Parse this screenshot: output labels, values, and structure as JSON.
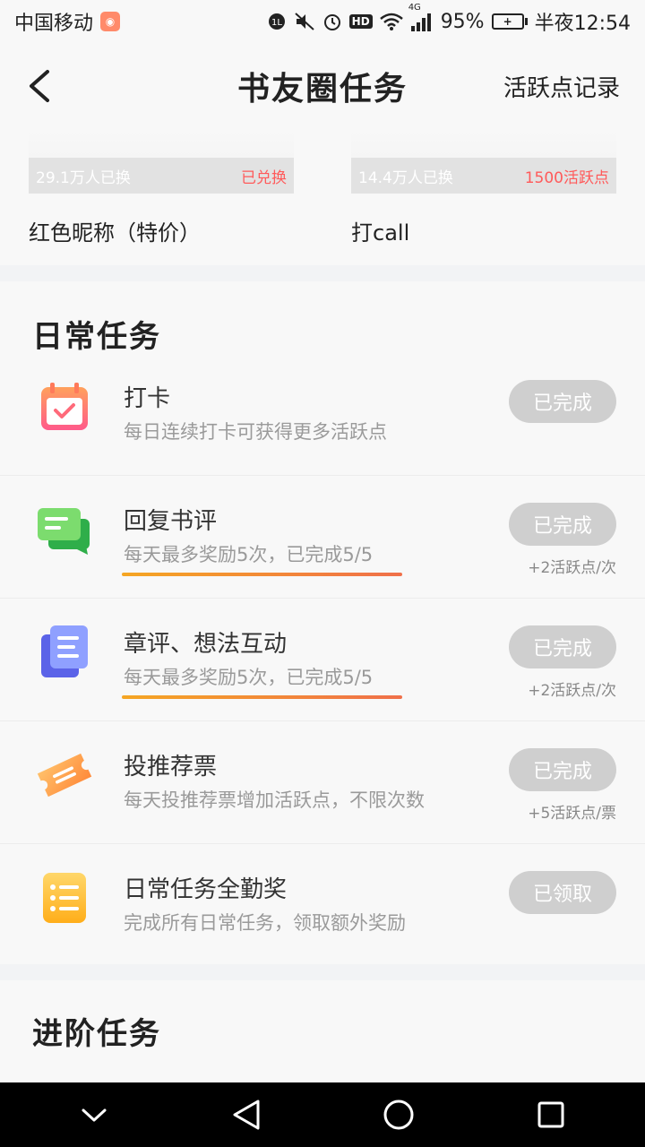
{
  "status_bar": {
    "carrier": "中国移动",
    "battery": "95%",
    "time": "半夜12:54",
    "network": "4G",
    "hd": "HD"
  },
  "header": {
    "title": "书友圈任务",
    "record_link": "活跃点记录"
  },
  "rewards": [
    {
      "count": "29.1万人已换",
      "price": "已兑换",
      "name": "红色昵称（特价）"
    },
    {
      "count": "14.4万人已换",
      "price": "1500活跃点",
      "name": "打call"
    }
  ],
  "daily": {
    "title": "日常任务",
    "tasks": [
      {
        "icon": "calendar-check-icon",
        "title": "打卡",
        "desc": "每日连续打卡可获得更多活跃点",
        "button": "已完成",
        "reward": ""
      },
      {
        "icon": "chat-bubbles-icon",
        "title": "回复书评",
        "desc": "每天最多奖励5次，已完成5/5",
        "button": "已完成",
        "reward": "+2活跃点/次",
        "progress": 1.0
      },
      {
        "icon": "document-stack-icon",
        "title": "章评、想法互动",
        "desc": "每天最多奖励5次，已完成5/5",
        "button": "已完成",
        "reward": "+2活跃点/次",
        "progress": 1.0
      },
      {
        "icon": "ticket-icon",
        "title": "投推荐票",
        "desc": "每天投推荐票增加活跃点，不限次数",
        "button": "已完成",
        "reward": "+5活跃点/票"
      },
      {
        "icon": "checklist-icon",
        "title": "日常任务全勤奖",
        "desc": "完成所有日常任务，领取额外奖励",
        "button": "已领取",
        "reward": ""
      }
    ]
  },
  "advanced": {
    "title": "进阶任务"
  },
  "colors": {
    "button_done": "#cfcfcf",
    "progress_start": "#f5a623",
    "progress_end": "#f0704a",
    "price_red": "#ff5a5a"
  }
}
